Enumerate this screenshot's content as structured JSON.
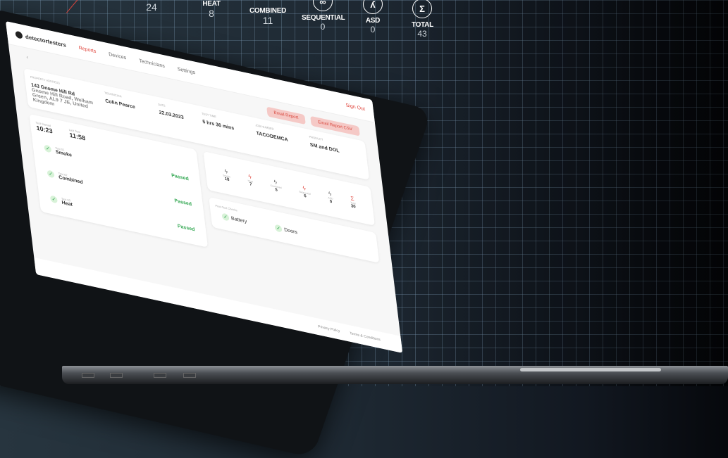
{
  "stats": [
    {
      "label": "",
      "value": "24",
      "icon": ""
    },
    {
      "label": "HEAT",
      "value": "8",
      "icon": ""
    },
    {
      "label": "COMBINED",
      "value": "11",
      "icon": ""
    },
    {
      "label": "SEQUENTIAL",
      "value": "0",
      "icon": "∞"
    },
    {
      "label": "ASD",
      "value": "0",
      "icon": "ʎ"
    },
    {
      "label": "TOTAL",
      "value": "43",
      "icon": "Σ"
    }
  ],
  "app": {
    "logo_text": "detectortesters",
    "nav": [
      "Reports",
      "Devices",
      "Technicians",
      "Settings"
    ],
    "sign_out": "Sign Out",
    "back": "‹",
    "buttons": [
      "Email Report",
      "Email Report CSV"
    ],
    "table_headers": [
      "Property Address",
      "Technician",
      "Date",
      "Test Time",
      "Job Number",
      "Product"
    ],
    "row": {
      "address": "143 Gnome Hill Rd",
      "address_detail": "Gnome Hill Road, Welham Green, AL9 7 JE, United Kingdom",
      "technician": "Colin Pearce",
      "date": "22.03.2023",
      "test_time": "5 hrs 36 mins",
      "job": "TACODEMCA",
      "product": "SM and DOL"
    },
    "times": [
      {
        "k": "Test Started",
        "v": "10:23"
      },
      {
        "k": "Last Test",
        "v": "11:58"
      }
    ],
    "tests": [
      {
        "small": "Test 01",
        "name": "Smoke",
        "status": "Passed"
      },
      {
        "small": "Test 02",
        "name": "Combined",
        "status": "Passed"
      },
      {
        "small": "Test 03",
        "name": "Heat",
        "status": "Passed"
      }
    ],
    "summary": [
      {
        "t": "Smoke",
        "n": "18",
        "red": false
      },
      {
        "t": "Heat",
        "n": "7",
        "red": true
      },
      {
        "t": "Combined",
        "n": "5",
        "red": false
      },
      {
        "t": "Sequential",
        "n": "6",
        "red": true
      },
      {
        "t": "ASD",
        "n": "0",
        "red": false
      },
      {
        "t": "Total",
        "n": "30",
        "red": true
      }
    ],
    "ptd_title": "Post-Test Checks",
    "ptd": [
      "Battery",
      "Doors"
    ],
    "footer": [
      "Privacy Policy",
      "Terms & Conditions"
    ]
  }
}
